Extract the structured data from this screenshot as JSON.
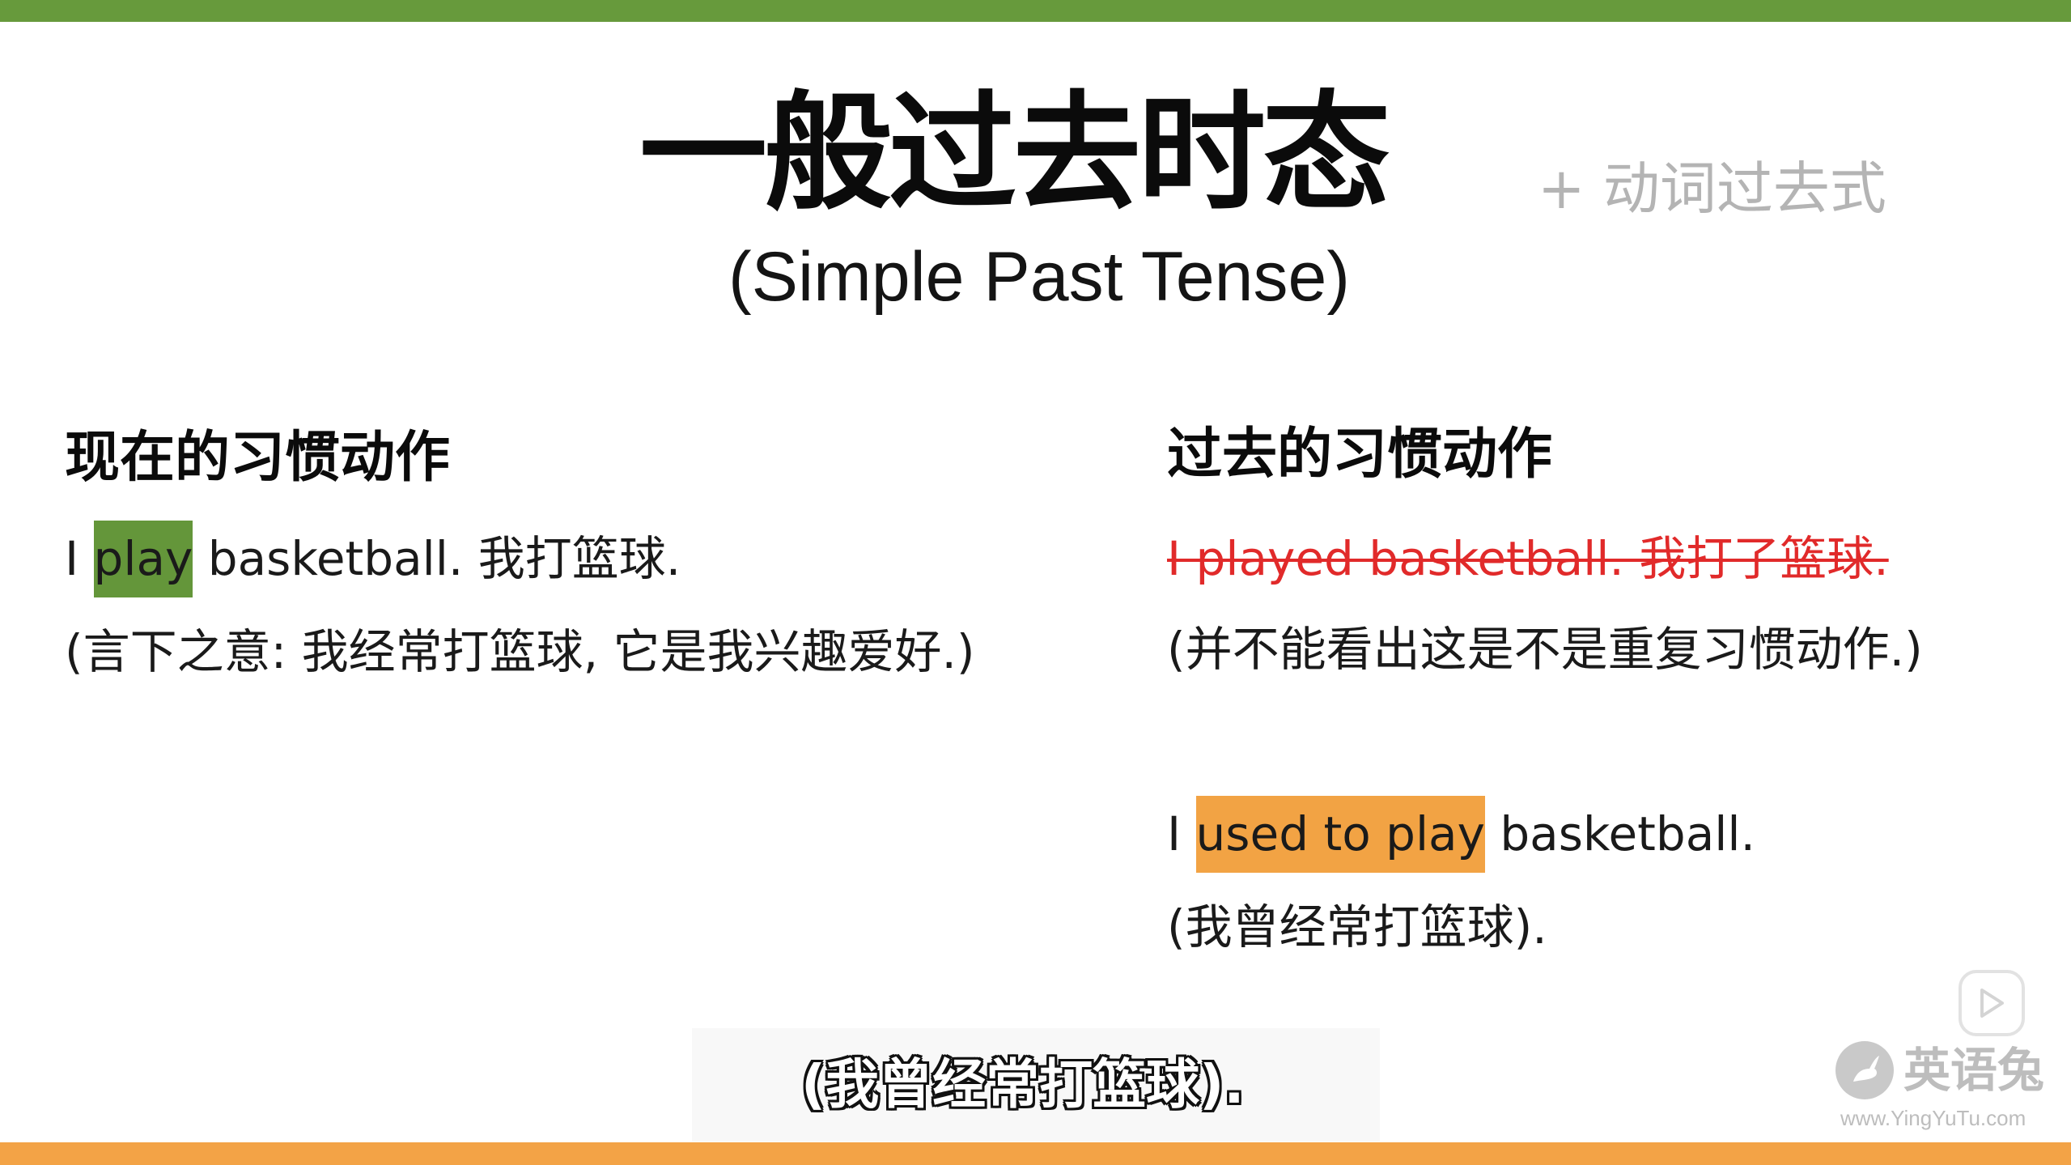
{
  "slide": {
    "title": "一般过去时态",
    "formula": "+ 动词过去式",
    "subtitle": "(Simple Past Tense)",
    "left_column": {
      "heading": "现在的习惯动作",
      "example_pre": "I ",
      "example_highlight": "play",
      "example_post": " basketball. 我打篮球.",
      "note": "(言下之意: 我经常打篮球, 它是我兴趣爱好.)"
    },
    "right_column": {
      "heading": "过去的习惯动作",
      "wrong_example": "I played basketball. 我打了篮球.",
      "wrong_note": "(并不能看出这是不是重复习惯动作.)",
      "example_pre": "I ",
      "example_highlight": "used to play",
      "example_post": " basketball.",
      "translation": "(我曾经常打篮球)."
    }
  },
  "video_caption": "(我曾经常打篮球).",
  "watermark": {
    "name": "英语兔",
    "url": "www.YingYuTu.com"
  },
  "icons": {
    "play": "play-icon",
    "logo": "rabbit-logo-icon"
  },
  "colors": {
    "top_bar": "#679a3c",
    "bottom_bar": "#f3a346",
    "highlight_green": "#64963a",
    "highlight_orange": "#f2a344",
    "strike_red": "#e12a2a"
  }
}
